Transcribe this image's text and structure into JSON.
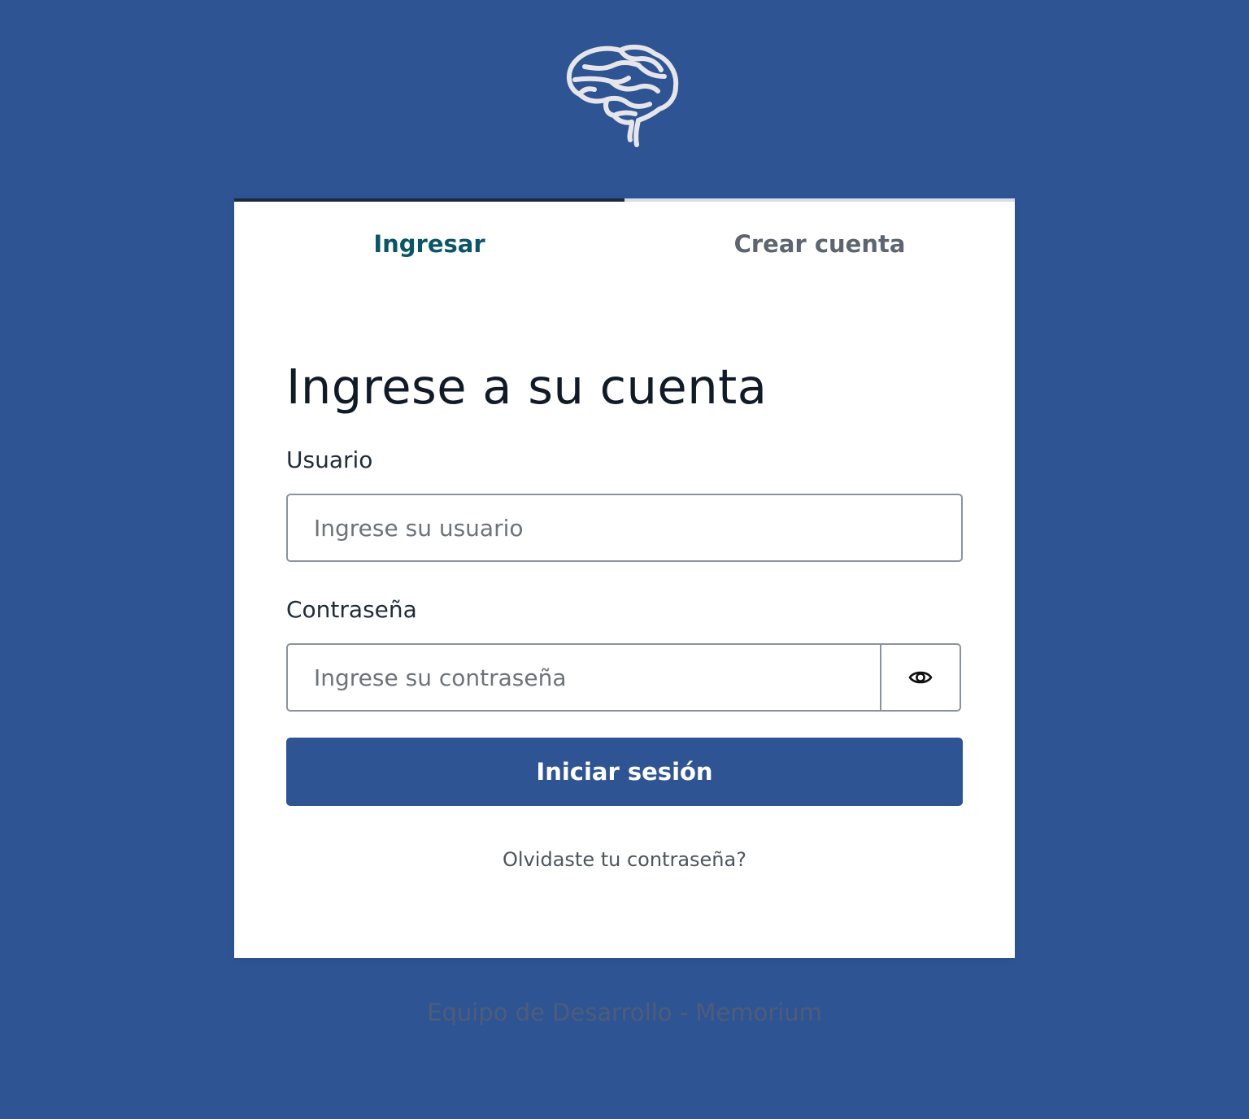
{
  "brand": {
    "logo_icon": "brain-icon"
  },
  "tabs": [
    {
      "label": "Ingresar",
      "active": true
    },
    {
      "label": "Crear cuenta",
      "active": false
    }
  ],
  "form": {
    "heading": "Ingrese a su cuenta",
    "username_label": "Usuario",
    "username_placeholder": "Ingrese su usuario",
    "username_value": "",
    "password_label": "Contraseña",
    "password_placeholder": "Ingrese su contraseña",
    "password_value": "",
    "toggle_icon": "eye-icon",
    "submit_label": "Iniciar sesión",
    "forgot_link": "Olvidaste tu contraseña?"
  },
  "footer": {
    "text": "Equipo de Desarrollo - Memorium"
  },
  "colors": {
    "background": "#2f5494",
    "card": "#ffffff",
    "active_tab_text": "#0b5566",
    "inactive_tab_text": "#5c6570",
    "button": "#2f5494"
  }
}
